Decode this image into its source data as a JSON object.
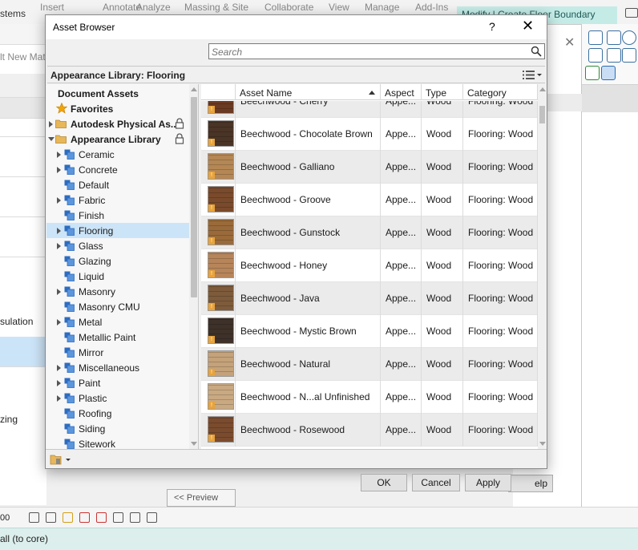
{
  "background_app": {
    "ribbon_tabs": [
      "stems",
      "Insert",
      "Annotate",
      "Analyze",
      "Massing & Site",
      "Collaborate",
      "View",
      "Manage",
      "Add-Ins"
    ],
    "active_tab": "Modify | Create Floor Boundary",
    "left_partial_texts": {
      "new_material": "lt New Mat",
      "insulation": "sulation",
      "glazing": "zing"
    },
    "help_button": "elp",
    "preview_button": "<< Preview",
    "view_scale": "00",
    "status_text": "all (to core)"
  },
  "asset_browser": {
    "title": "Asset Browser",
    "help_glyph": "?",
    "close_glyph": "✕",
    "search_placeholder": "Search",
    "library_header": "Appearance Library: Flooring",
    "tree": {
      "document_assets": "Document Assets",
      "favorites": "Favorites",
      "autodesk_physical": "Autodesk Physical As...",
      "appearance_library": "Appearance Library",
      "categories": [
        {
          "label": "Ceramic",
          "expandable": true
        },
        {
          "label": "Concrete",
          "expandable": true
        },
        {
          "label": "Default",
          "expandable": false
        },
        {
          "label": "Fabric",
          "expandable": true
        },
        {
          "label": "Finish",
          "expandable": false
        },
        {
          "label": "Flooring",
          "expandable": true,
          "selected": true
        },
        {
          "label": "Glass",
          "expandable": true
        },
        {
          "label": "Glazing",
          "expandable": false
        },
        {
          "label": "Liquid",
          "expandable": false
        },
        {
          "label": "Masonry",
          "expandable": true
        },
        {
          "label": "Masonry CMU",
          "expandable": false
        },
        {
          "label": "Metal",
          "expandable": true
        },
        {
          "label": "Metallic Paint",
          "expandable": false
        },
        {
          "label": "Mirror",
          "expandable": false
        },
        {
          "label": "Miscellaneous",
          "expandable": true
        },
        {
          "label": "Paint",
          "expandable": true
        },
        {
          "label": "Plastic",
          "expandable": true
        },
        {
          "label": "Roofing",
          "expandable": false
        },
        {
          "label": "Siding",
          "expandable": false
        },
        {
          "label": "Sitework",
          "expandable": false
        }
      ]
    },
    "columns": {
      "name": "Asset Name",
      "aspect": "Aspect",
      "type": "Type",
      "category": "Category"
    },
    "rows": [
      {
        "name": "Beechwood - Cherry",
        "aspect": "Appe...",
        "type": "Wood",
        "category": "Flooring: Wood",
        "swatch": "#6b3a22"
      },
      {
        "name": "Beechwood - Chocolate Brown",
        "aspect": "Appe...",
        "type": "Wood",
        "category": "Flooring: Wood",
        "swatch": "#4a3426"
      },
      {
        "name": "Beechwood - Galliano",
        "aspect": "Appe...",
        "type": "Wood",
        "category": "Flooring: Wood",
        "swatch": "#b48755"
      },
      {
        "name": "Beechwood - Groove",
        "aspect": "Appe...",
        "type": "Wood",
        "category": "Flooring: Wood",
        "swatch": "#7a4a2c"
      },
      {
        "name": "Beechwood - Gunstock",
        "aspect": "Appe...",
        "type": "Wood",
        "category": "Flooring: Wood",
        "swatch": "#9a6a3a"
      },
      {
        "name": "Beechwood - Honey",
        "aspect": "Appe...",
        "type": "Wood",
        "category": "Flooring: Wood",
        "swatch": "#b7855a"
      },
      {
        "name": "Beechwood - Java",
        "aspect": "Appe...",
        "type": "Wood",
        "category": "Flooring: Wood",
        "swatch": "#7d5b3b"
      },
      {
        "name": "Beechwood - Mystic Brown",
        "aspect": "Appe...",
        "type": "Wood",
        "category": "Flooring: Wood",
        "swatch": "#3e3129"
      },
      {
        "name": "Beechwood - Natural",
        "aspect": "Appe...",
        "type": "Wood",
        "category": "Flooring: Wood",
        "swatch": "#c4a27a"
      },
      {
        "name": "Beechwood - N...al Unfinished",
        "aspect": "Appe...",
        "type": "Wood",
        "category": "Flooring: Wood",
        "swatch": "#c9a982"
      },
      {
        "name": "Beechwood - Rosewood",
        "aspect": "Appe...",
        "type": "Wood",
        "category": "Flooring: Wood",
        "swatch": "#7b4b2e"
      }
    ],
    "buttons": {
      "ok": "OK",
      "cancel": "Cancel",
      "apply": "Apply"
    }
  },
  "colors": {
    "selection": "#cce4f7",
    "active_tab": "#c5ebe7",
    "status_bar": "#dcefec",
    "folder": "#e8b75a",
    "category_icon": "#2d6cc0",
    "favorite_star": "#f0a30a"
  }
}
